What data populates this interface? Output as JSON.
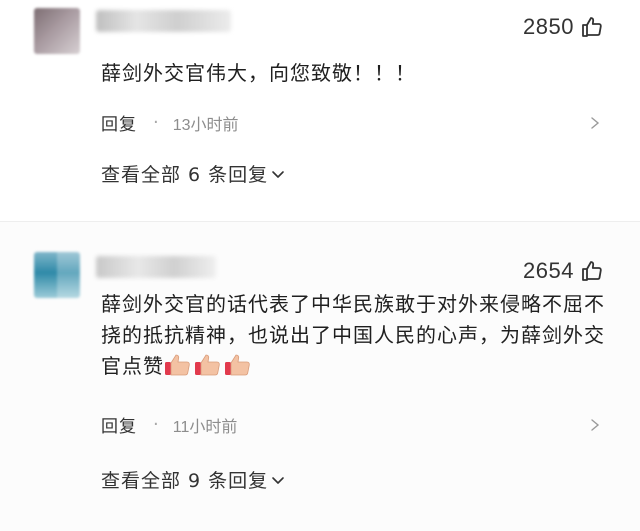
{
  "comments": [
    {
      "likes": "2850",
      "text": "薛剑外交官伟大，向您致敬！！！",
      "reply_label": "回复",
      "separator": "·",
      "time": "13小时前",
      "view_replies": "查看全部 6 条回复"
    },
    {
      "likes": "2654",
      "text": "薛剑外交官的话代表了中华民族敢于对外来侵略不屈不挠的抵抗精神，也说出了中国人民的心声，为薛剑外交官点赞",
      "reply_label": "回复",
      "separator": "·",
      "time": "11小时前",
      "view_replies": "查看全部 9 条回复",
      "emojis": [
        "thumbs-up",
        "thumbs-up",
        "thumbs-up"
      ]
    }
  ],
  "colors": {
    "text": "#1f1f1f",
    "meta_time": "#8d8d8d",
    "emoji_skin": "#f3c2a3",
    "emoji_cuff": "#e23a4d"
  }
}
